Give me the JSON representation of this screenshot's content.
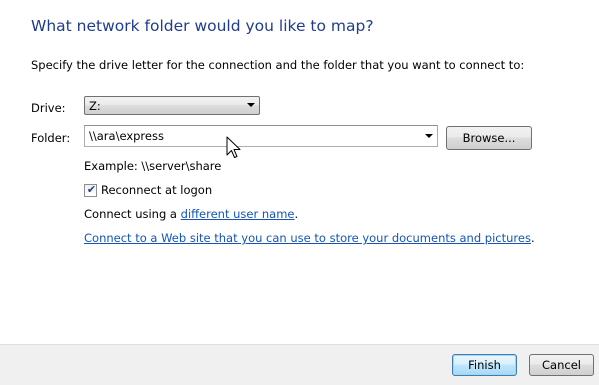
{
  "heading": "What network folder would you like to map?",
  "instruction": "Specify the drive letter for the connection and the folder that you want to connect to:",
  "drive": {
    "label": "Drive:",
    "value": "Z:"
  },
  "folder": {
    "label": "Folder:",
    "value": "\\\\ara\\express",
    "browse_label": "Browse..."
  },
  "example": "Example: \\\\server\\share",
  "reconnect": {
    "label": "Reconnect at logon",
    "checked": true
  },
  "connect_using": {
    "prefix": "Connect using a ",
    "link": "different user name",
    "suffix": "."
  },
  "web_site": {
    "link": "Connect to a Web site that you can use to store your documents and pictures",
    "suffix": "."
  },
  "footer": {
    "finish_label": "Finish",
    "cancel_label": "Cancel"
  },
  "colors": {
    "heading": "#1f3d8f",
    "link": "#1554b6",
    "footer_bg": "#f0f0f0"
  },
  "icons": {
    "cursor": "arrow-cursor-icon",
    "checkmark": "checkmark-icon",
    "dropdown": "chevron-down-icon"
  }
}
